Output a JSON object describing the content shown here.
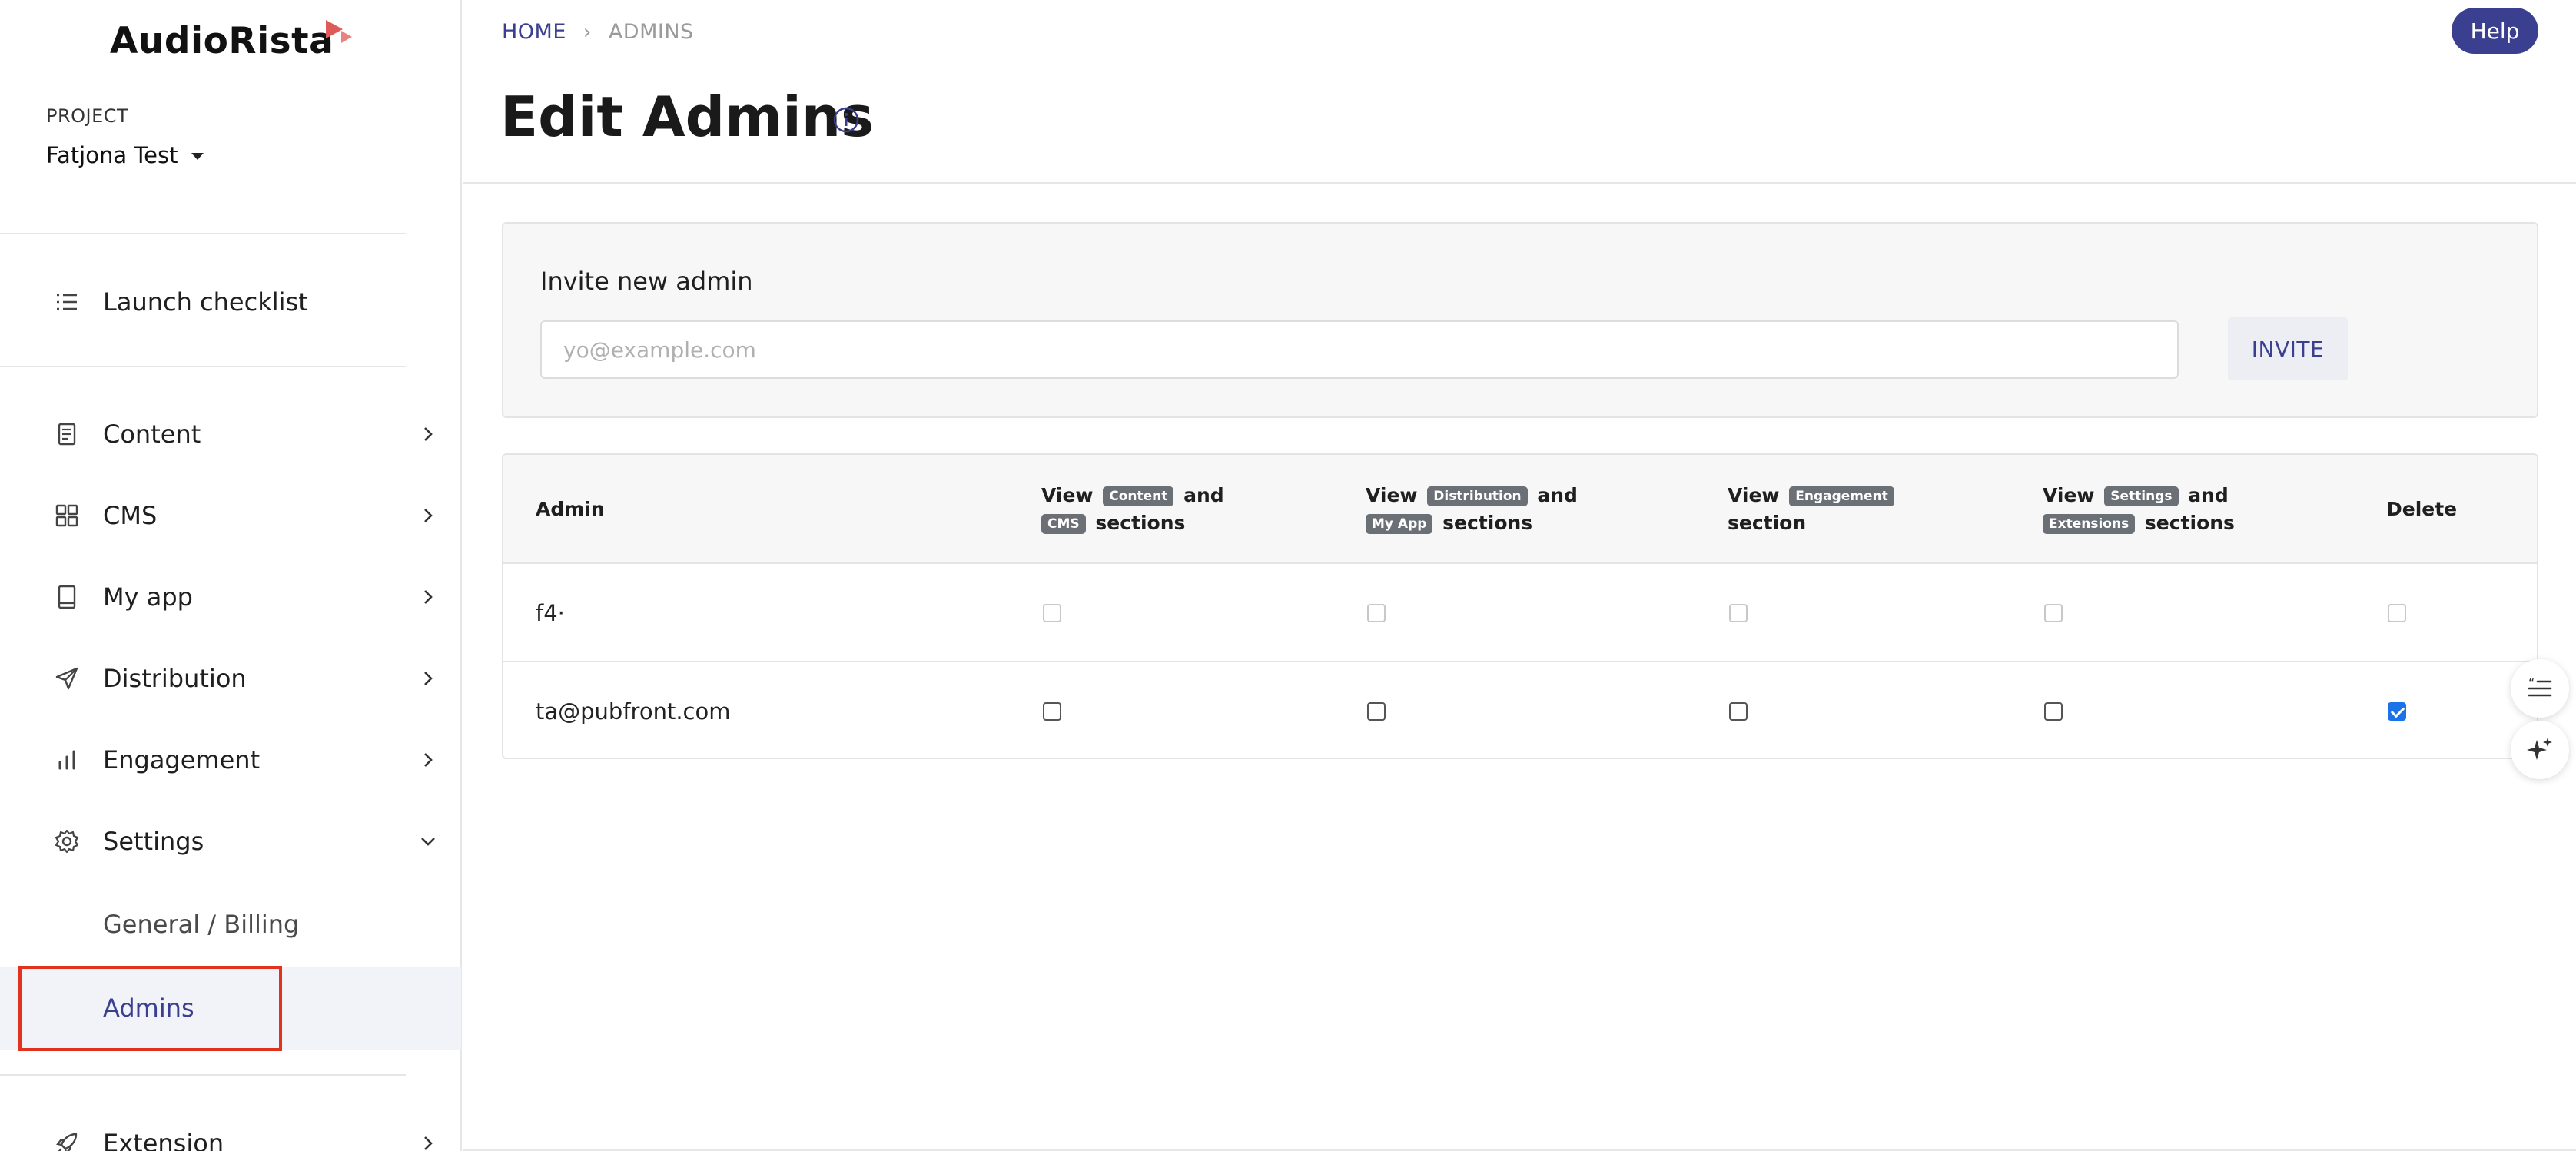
{
  "app": {
    "name": "AudioRista"
  },
  "project": {
    "label": "PROJECT",
    "selected": "Fatjona Test"
  },
  "sidebar": {
    "launch_checklist": "Launch checklist",
    "items": [
      {
        "label": "Content",
        "icon": "document-icon"
      },
      {
        "label": "CMS",
        "icon": "grid-icon"
      },
      {
        "label": "My app",
        "icon": "tablet-icon"
      },
      {
        "label": "Distribution",
        "icon": "send-icon"
      },
      {
        "label": "Engagement",
        "icon": "bar-chart-icon"
      },
      {
        "label": "Settings",
        "icon": "gear-icon"
      }
    ],
    "settings_sub": [
      {
        "label": "General / Billing"
      },
      {
        "label": "Admins"
      }
    ],
    "extension": {
      "label": "Extension",
      "icon": "rocket-icon"
    }
  },
  "header": {
    "breadcrumb": {
      "home": "HOME",
      "separator": "›",
      "current": "ADMINS"
    },
    "help_label": "Help",
    "title": "Edit Admins"
  },
  "invite": {
    "title": "Invite new admin",
    "placeholder": "yo@example.com",
    "value": "",
    "button_label": "INVITE"
  },
  "table": {
    "headers": {
      "admin": "Admin",
      "content": {
        "pre": "View",
        "tag1": "Content",
        "mid": "and",
        "tag2": "CMS",
        "post": "sections"
      },
      "distribution": {
        "pre": "View",
        "tag1": "Distribution",
        "mid": "and",
        "tag2": "My App",
        "post": "sections"
      },
      "engagement": {
        "pre": "View",
        "tag1": "Engagement",
        "post": "section"
      },
      "settings": {
        "pre": "View",
        "tag1": "Settings",
        "mid": "and",
        "tag2": "Extensions",
        "post": "sections"
      },
      "delete": "Delete"
    },
    "rows": [
      {
        "admin": "f4·",
        "content": false,
        "distribution": false,
        "engagement": false,
        "settings": false,
        "delete": false,
        "disabled": true
      },
      {
        "admin": "ta@pubfront.com",
        "content": false,
        "distribution": false,
        "engagement": false,
        "settings": false,
        "delete": true,
        "disabled": false
      }
    ]
  },
  "colors": {
    "accent": "#3b3f8f",
    "brand_mark": "#e05a5a",
    "highlight": "#e0321f",
    "checkbox_checked": "#1a73e8"
  }
}
